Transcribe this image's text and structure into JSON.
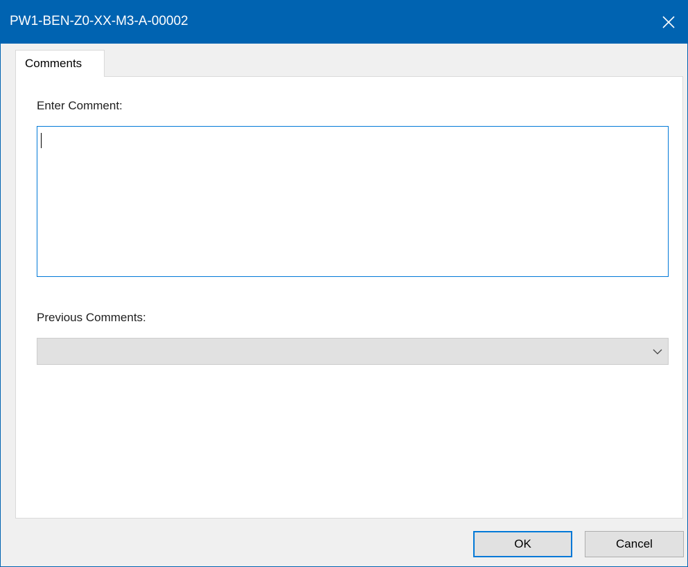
{
  "window": {
    "title": "PW1-BEN-Z0-XX-M3-A-00002",
    "close_icon": "close-icon",
    "title_bar_color": "#0063b1"
  },
  "tabs": [
    {
      "label": "Comments",
      "selected": true
    }
  ],
  "comment": {
    "label": "Enter Comment:",
    "value": "",
    "focus_color": "#0078d7"
  },
  "previous_comments": {
    "label": "Previous Comments:",
    "selected_value": "",
    "dropdown_icon": "chevron-down-icon"
  },
  "buttons": {
    "ok_label": "OK",
    "cancel_label": "Cancel"
  }
}
